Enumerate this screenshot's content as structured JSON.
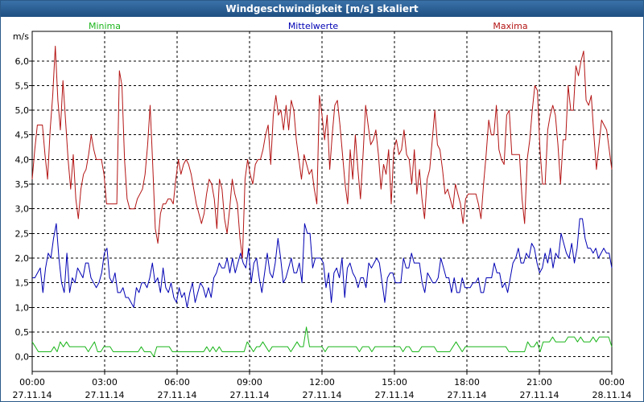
{
  "window": {
    "title": "Windgeschwindigkeit [m/s] skaliert"
  },
  "chart_data": {
    "type": "line",
    "title": "Windgeschwindigkeit [m/s] skaliert",
    "ylabel": "m/s",
    "ylim": [
      -0.3,
      6.6
    ],
    "yticks": [
      0.0,
      0.5,
      1.0,
      1.5,
      2.0,
      2.5,
      3.0,
      3.5,
      4.0,
      4.5,
      5.0,
      5.5,
      6.0
    ],
    "ytick_labels": [
      "0,0",
      "0,5",
      "1,0",
      "1,5",
      "2,0",
      "2,5",
      "3,0",
      "3,5",
      "4,0",
      "4,5",
      "5,0",
      "5,5",
      "6,0"
    ],
    "xlim": [
      0,
      24
    ],
    "xticks": [
      {
        "hour": 0,
        "time": "00:00",
        "date": "27.11.14"
      },
      {
        "hour": 3,
        "time": "03:00",
        "date": "27.11.14"
      },
      {
        "hour": 6,
        "time": "06:00",
        "date": "27.11.14"
      },
      {
        "hour": 9,
        "time": "09:00",
        "date": "27.11.14"
      },
      {
        "hour": 12,
        "time": "12:00",
        "date": "27.11.14"
      },
      {
        "hour": 15,
        "time": "15:00",
        "date": "27.11.14"
      },
      {
        "hour": 18,
        "time": "18:00",
        "date": "27.11.14"
      },
      {
        "hour": 21,
        "time": "21:00",
        "date": "27.11.14"
      },
      {
        "hour": 24,
        "time": "00:00",
        "date": "28.11.14"
      }
    ],
    "grid": true,
    "legend": "top",
    "series": [
      {
        "name": "Minima",
        "color": "#1cb51c",
        "values": [
          0.3,
          0.2,
          0.1,
          0.1,
          0.1,
          0.1,
          0.1,
          0.2,
          0.1,
          0.3,
          0.2,
          0.3,
          0.2,
          0.2,
          0.2,
          0.2,
          0.2,
          0.2,
          0.1,
          0.2,
          0.3,
          0.1,
          0.1,
          0.2,
          0.2,
          0.2,
          0.1,
          0.1,
          0.1,
          0.1,
          0.1,
          0.1,
          0.1,
          0.1,
          0.1,
          0.2,
          0.1,
          0.1,
          0.1,
          0.0,
          0.2,
          0.2,
          0.2,
          0.2,
          0.2,
          0.1,
          0.1,
          0.1,
          0.1,
          0.1,
          0.1,
          0.1,
          0.1,
          0.1,
          0.1,
          0.1,
          0.2,
          0.1,
          0.2,
          0.1,
          0.2,
          0.1,
          0.1,
          0.1,
          0.1,
          0.1,
          0.1,
          0.1,
          0.1,
          0.3,
          0.2,
          0.1,
          0.2,
          0.2,
          0.3,
          0.2,
          0.1,
          0.2,
          0.2,
          0.2,
          0.2,
          0.2,
          0.2,
          0.1,
          0.2,
          0.3,
          0.2,
          0.2,
          0.6,
          0.2,
          0.2,
          0.2,
          0.2,
          0.2,
          0.1,
          0.2,
          0.2,
          0.2,
          0.2,
          0.2,
          0.2,
          0.2,
          0.2,
          0.2,
          0.2,
          0.1,
          0.2,
          0.2,
          0.2,
          0.1,
          0.2,
          0.2,
          0.2,
          0.2,
          0.2,
          0.2,
          0.2,
          0.2,
          0.2,
          0.1,
          0.2,
          0.2,
          0.1,
          0.1,
          0.1,
          0.2,
          0.2,
          0.2,
          0.2,
          0.2,
          0.1,
          0.1,
          0.1,
          0.1,
          0.1,
          0.2,
          0.3,
          0.2,
          0.1,
          0.2,
          0.2,
          0.2,
          0.2,
          0.2,
          0.2,
          0.2,
          0.2,
          0.2,
          0.2,
          0.2,
          0.2,
          0.2,
          0.2,
          0.1,
          0.1,
          0.1,
          0.1,
          0.1,
          0.1,
          0.3,
          0.2,
          0.2,
          0.3,
          0.1,
          0.3,
          0.3,
          0.3,
          0.4,
          0.3,
          0.3,
          0.3,
          0.3,
          0.4,
          0.4,
          0.4,
          0.3,
          0.4,
          0.3,
          0.3,
          0.3,
          0.4,
          0.3,
          0.4,
          0.4,
          0.4,
          0.4,
          0.2
        ]
      },
      {
        "name": "Mittelwerte",
        "color": "#0000b4",
        "values": [
          1.6,
          1.6,
          1.7,
          1.8,
          1.3,
          1.8,
          2.1,
          2.0,
          2.4,
          2.7,
          2.0,
          1.5,
          1.3,
          2.1,
          1.3,
          1.6,
          1.5,
          1.8,
          1.7,
          1.6,
          1.9,
          1.9,
          1.6,
          1.5,
          1.4,
          1.5,
          1.7,
          2.1,
          2.2,
          1.6,
          1.5,
          1.7,
          1.3,
          1.3,
          1.4,
          1.2,
          1.2,
          1.1,
          1.0,
          1.4,
          1.3,
          1.5,
          1.5,
          1.4,
          1.6,
          1.9,
          1.5,
          1.6,
          1.3,
          1.8,
          1.4,
          1.3,
          1.5,
          1.2,
          1.1,
          1.4,
          1.2,
          1.3,
          1.0,
          1.3,
          1.5,
          1.1,
          1.3,
          1.5,
          1.4,
          1.2,
          1.4,
          1.2,
          1.6,
          1.7,
          1.9,
          1.8,
          1.8,
          2.0,
          1.7,
          2.0,
          1.7,
          1.9,
          2.1,
          1.9,
          1.8,
          2.2,
          1.5,
          1.9,
          2.0,
          1.6,
          1.3,
          1.7,
          2.1,
          1.7,
          1.6,
          1.9,
          2.4,
          2.0,
          1.5,
          1.6,
          1.8,
          2.0,
          1.7,
          1.7,
          1.9,
          1.5,
          2.7,
          2.5,
          2.5,
          1.8,
          2.0,
          2.0,
          2.0,
          1.9,
          1.4,
          1.7,
          1.1,
          1.7,
          1.8,
          1.6,
          2.0,
          1.2,
          1.8,
          1.9,
          1.7,
          1.6,
          1.4,
          1.6,
          1.6,
          1.4,
          1.9,
          1.8,
          1.9,
          2.0,
          1.9,
          1.5,
          1.1,
          1.6,
          1.7,
          1.7,
          1.5,
          1.5,
          1.5,
          2.0,
          1.8,
          1.8,
          2.1,
          1.9,
          1.9,
          1.9,
          1.5,
          1.3,
          1.7,
          1.6,
          1.5,
          1.5,
          1.6,
          2.0,
          1.8,
          1.6,
          1.6,
          1.3,
          1.6,
          1.3,
          1.3,
          1.6,
          1.4,
          1.4,
          1.4,
          1.5,
          1.5,
          1.6,
          1.3,
          1.3,
          1.6,
          1.6,
          1.6,
          1.9,
          1.7,
          1.7,
          1.4,
          1.5,
          1.3,
          1.6,
          1.9,
          2.0,
          2.2,
          1.9,
          1.9,
          2.1,
          2.0,
          2.3,
          2.2,
          1.9,
          1.7,
          1.8,
          2.1,
          1.9,
          2.2,
          1.8,
          2.1,
          2.0,
          2.5,
          2.3,
          2.1,
          2.0,
          2.3,
          1.9,
          2.2,
          2.8,
          2.8,
          2.4,
          2.2,
          2.2,
          2.1,
          2.2,
          2.0,
          2.1,
          2.2,
          2.1,
          2.1,
          1.8
        ]
      },
      {
        "name": "Maxima",
        "color": "#b41414",
        "values": [
          3.6,
          4.2,
          4.7,
          4.7,
          4.7,
          4.1,
          3.6,
          4.6,
          5.3,
          6.3,
          5.2,
          4.6,
          5.6,
          4.8,
          4.0,
          3.4,
          4.1,
          3.2,
          2.8,
          3.4,
          3.7,
          3.8,
          4.1,
          4.5,
          4.2,
          4.0,
          4.0,
          4.0,
          3.7,
          3.1,
          3.1,
          3.1,
          3.1,
          3.1,
          5.8,
          5.5,
          4.0,
          3.2,
          3.0,
          3.0,
          3.0,
          3.2,
          3.3,
          3.4,
          3.7,
          4.3,
          5.1,
          3.9,
          2.6,
          2.3,
          2.9,
          3.1,
          3.1,
          3.2,
          3.2,
          3.1,
          3.6,
          4.0,
          3.7,
          3.9,
          4.0,
          3.9,
          3.7,
          3.4,
          3.1,
          2.9,
          2.7,
          2.9,
          3.3,
          3.6,
          3.5,
          3.2,
          2.6,
          3.6,
          3.4,
          2.8,
          2.5,
          3.0,
          3.6,
          3.3,
          3.1,
          2.4,
          2.0,
          3.6,
          4.0,
          3.7,
          3.5,
          3.9,
          4.0,
          4.0,
          4.2,
          4.5,
          4.7,
          3.9,
          4.9,
          5.3,
          4.9,
          5.0,
          4.6,
          5.1,
          4.6,
          5.2,
          5.0,
          4.4,
          4.0,
          3.6,
          4.1,
          3.9,
          3.7,
          3.8,
          3.4,
          3.1,
          5.3,
          4.9,
          4.4,
          4.9,
          3.8,
          4.5,
          5.1,
          5.2,
          4.7,
          4.1,
          3.5,
          3.1,
          4.2,
          3.6,
          4.5,
          3.8,
          3.2,
          4.1,
          5.1,
          4.7,
          4.3,
          4.4,
          4.6,
          4.1,
          3.4,
          3.9,
          3.7,
          4.2,
          3.1,
          4.2,
          4.4,
          4.1,
          4.2,
          4.6,
          4.1,
          4.0,
          3.5,
          4.2,
          3.3,
          3.8,
          3.2,
          2.8,
          3.6,
          3.8,
          4.4,
          5.0,
          4.3,
          4.2,
          3.8,
          3.3,
          3.4,
          3.2,
          3.0,
          3.5,
          3.3,
          3.1,
          2.7,
          3.2,
          3.3,
          3.3,
          3.3,
          3.3,
          3.1,
          2.8,
          3.5,
          4.1,
          4.8,
          4.5,
          4.5,
          5.1,
          4.2,
          4.0,
          3.9,
          4.9,
          5.0,
          4.1,
          4.1,
          4.1,
          4.1,
          3.2,
          2.7,
          4.0,
          4.4,
          5.0,
          5.5,
          5.4,
          4.2,
          3.5,
          3.5,
          4.6,
          4.9,
          5.1,
          4.9,
          4.3,
          3.5,
          4.4,
          4.4,
          5.5,
          5.0,
          5.0,
          5.9,
          5.7,
          6.0,
          6.2,
          5.2,
          5.1,
          5.3,
          4.5,
          3.8,
          4.3,
          4.8,
          4.7,
          4.6,
          4.2,
          3.8
        ]
      }
    ]
  }
}
